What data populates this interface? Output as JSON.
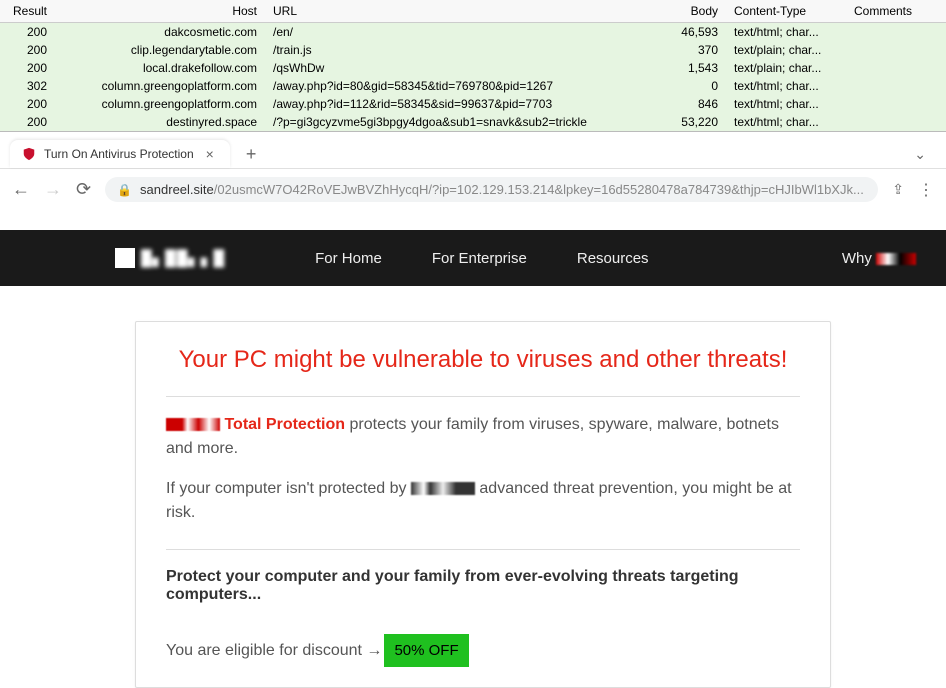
{
  "table": {
    "headers": {
      "result": "Result",
      "host": "Host",
      "url": "URL",
      "body": "Body",
      "ct": "Content-Type",
      "comments": "Comments"
    },
    "rows": [
      {
        "result": "200",
        "host": "dakcosmetic.com",
        "url": "/en/",
        "body": "46,593",
        "ct": "text/html; char...",
        "comments": ""
      },
      {
        "result": "200",
        "host": "clip.legendarytable.com",
        "url": "/train.js",
        "body": "370",
        "ct": "text/plain; char...",
        "comments": ""
      },
      {
        "result": "200",
        "host": "local.drakefollow.com",
        "url": "/qsWhDw",
        "body": "1,543",
        "ct": "text/plain; char...",
        "comments": ""
      },
      {
        "result": "302",
        "host": "column.greengoplatform.com",
        "url": "/away.php?id=80&gid=58345&tid=769780&pid=1267",
        "body": "0",
        "ct": "text/html; char...",
        "comments": ""
      },
      {
        "result": "200",
        "host": "column.greengoplatform.com",
        "url": "/away.php?id=112&rid=58345&sid=99637&pid=7703",
        "body": "846",
        "ct": "text/html; char...",
        "comments": ""
      },
      {
        "result": "200",
        "host": "destinyred.space",
        "url": "/?p=gi3gcyzvme5gi3bpgy4dgoa&sub1=snavk&sub2=trickle",
        "body": "53,220",
        "ct": "text/html; char...",
        "comments": ""
      }
    ]
  },
  "browser": {
    "tab_title": "Turn On Antivirus Protection",
    "url_host": "sandreel.site",
    "url_path": "/02usmcW7O42RoVEJwBVZhHycqH/?ip=102.129.153.214&lpkey=16d55280478a784739&thjp=cHJIbWl1bXJk..."
  },
  "nav": {
    "home": "For Home",
    "enterprise": "For Enterprise",
    "resources": "Resources",
    "why": "Why"
  },
  "page": {
    "headline": "Your PC might be vulnerable to viruses and other threats!",
    "tp_label": "Total Protection",
    "tp_rest": " protects your family from viruses, spyware, malware, botnets and more.",
    "line2_a": "If your computer isn't protected by ",
    "line2_b": " advanced threat prevention, you might be at risk.",
    "protect": "Protect your computer and your family from ever-evolving threats targeting computers...",
    "eligible": "You are eligible for discount → ",
    "discount": "50% OFF"
  }
}
